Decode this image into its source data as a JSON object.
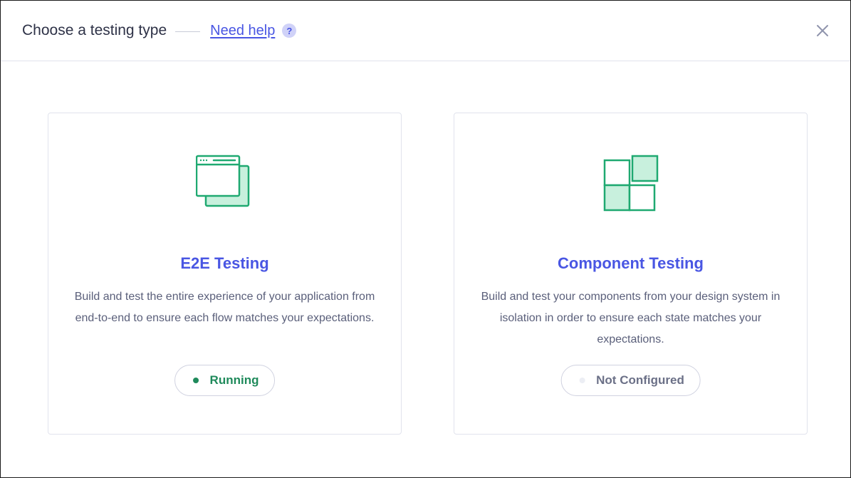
{
  "header": {
    "title": "Choose a testing type",
    "help_link": "Need help",
    "help_icon_glyph": "?",
    "close_icon": "close-icon"
  },
  "cards": [
    {
      "id": "e2e",
      "icon": "browser-windows-icon",
      "title": "E2E Testing",
      "description": "Build and test the entire experience of your application from end-to-end to ensure each flow matches your expectations.",
      "status": "Running",
      "status_color": "#1f8a5b"
    },
    {
      "id": "component",
      "icon": "component-blocks-icon",
      "title": "Component Testing",
      "description": "Build and test your components from your design system in isolation in order to ensure each state matches your expectations.",
      "status": "Not Configured",
      "status_color": "#6b7087"
    }
  ],
  "colors": {
    "accent": "#4956e3",
    "icon_green": "#1fa971",
    "icon_green_fill": "#c8f0dd",
    "running": "#1f8a5b"
  }
}
